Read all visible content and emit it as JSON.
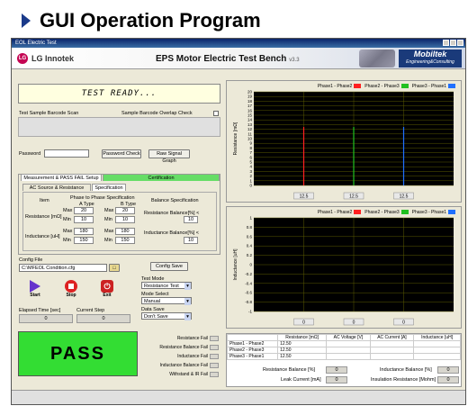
{
  "slide": {
    "title": "GUI Operation Program"
  },
  "window": {
    "title": "EOL Electric Test"
  },
  "header": {
    "company": "LG Innotek",
    "logo_mark": "LG",
    "title": "EPS Motor Electric Test Bench",
    "version": "v3.3",
    "brand": "Mobiltek",
    "brand_sub": "Engineering&Consulting"
  },
  "status": {
    "text": "TEST READY..."
  },
  "barcode": {
    "label": "Test Sample Barcode Scan",
    "overlap_label": "Sample Barcode Overlap Check"
  },
  "password": {
    "label": "Password",
    "value": "",
    "check_button": "Password Check",
    "raw_button": "Raw Signal Graph"
  },
  "setup": {
    "tab_main": "Measurement & PASS FAIL Setup",
    "tab_cert": "Certification",
    "subtab_ac": "AC Source & Resistance Setup",
    "subtab_spec": "Specification",
    "item_header": "Item",
    "phase_header": "Phase to Phase Specification",
    "a_type": "A Type",
    "b_type": "B Type",
    "balance_header": "Balance Specification",
    "resistance_label": "Resistance [mΩ]",
    "inductance_label": "Inductance [uH]",
    "max": "Max",
    "min": "Min",
    "res_a_max": "20",
    "res_a_min": "10",
    "res_b_max": "20",
    "res_b_min": "10",
    "ind_a_max": "180",
    "ind_a_min": "150",
    "ind_b_max": "180",
    "ind_b_min": "150",
    "res_balance_label": "Resistance Balance[%] <",
    "res_balance_value": "10",
    "ind_balance_label": "Inductance Balance[%] <",
    "ind_balance_value": "10"
  },
  "config": {
    "label": "Config File",
    "value": "C:\\MFEOL Condition.cfg",
    "save_button": "Config Save"
  },
  "controls": {
    "start": "Start",
    "stop": "Stop",
    "exit": "Exit"
  },
  "modes": {
    "test_mode_label": "Test Mode",
    "test_mode_value": "Resistance Test",
    "mode_select_label": "Mode Select",
    "mode_select_value": "Manual",
    "data_save_label": "Data Save",
    "data_save_value": "Don't Save"
  },
  "timing": {
    "elapsed_label": "Elapsed Time [sec]",
    "elapsed_value": "0",
    "step_label": "Current Step",
    "step_value": "0"
  },
  "result": {
    "text": "PASS",
    "color": "#33dd33"
  },
  "fails": [
    {
      "label": "Resistance Fail"
    },
    {
      "label": "Resistance Balance Fail"
    },
    {
      "label": "Inductance Fail"
    },
    {
      "label": "Inductance Balance Fail"
    },
    {
      "label": "Withstand & IR Fail"
    }
  ],
  "chart_data": [
    {
      "type": "bar",
      "categories": [
        "Phase1 - Phase2",
        "Phase2 - Phase3",
        "Phase3 - Phase1"
      ],
      "values": [
        12.5,
        12.5,
        12.5
      ],
      "colors": [
        "#ff2020",
        "#20c020",
        "#2070ff"
      ],
      "title": "",
      "xlabel": "",
      "ylabel": "Resistance [mΩ]",
      "ylim": [
        0,
        20
      ],
      "yticks": [
        "0",
        "1",
        "2",
        "3",
        "4",
        "5",
        "6",
        "7",
        "8",
        "9",
        "10",
        "11",
        "12",
        "13",
        "14",
        "15",
        "16",
        "17",
        "18",
        "19",
        "20"
      ],
      "legend": "top-right",
      "value_labels": [
        "12.5",
        "12.5",
        "12.5"
      ]
    },
    {
      "type": "bar",
      "categories": [
        "Phase1 - Phase2",
        "Phase2 - Phase3",
        "Phase3 - Phase1"
      ],
      "values": [
        0,
        0,
        0
      ],
      "colors": [
        "#ff2020",
        "#20c020",
        "#2070ff"
      ],
      "title": "",
      "xlabel": "",
      "ylabel": "Inductance [uH]",
      "ylim": [
        -1,
        1
      ],
      "yticks": [
        "-1",
        "-0.8",
        "-0.6",
        "-0.4",
        "-0.2",
        "0",
        "0.2",
        "0.4",
        "0.6",
        "0.8",
        "1"
      ],
      "legend": "top-right",
      "value_labels": [
        "0",
        "0",
        "0"
      ]
    }
  ],
  "results": {
    "headers": [
      "",
      "Resistance [mΩ]",
      "AC Voltage [V]",
      "AC Current [A]",
      "Inductance [uH]"
    ],
    "rows": [
      [
        "Phase1 - Phase2",
        "12.50",
        "",
        "",
        ""
      ],
      [
        "Phase2 - Phase3",
        "12.50",
        "",
        "",
        ""
      ],
      [
        "Phase3 - Phase1",
        "12.50",
        "",
        "",
        ""
      ]
    ],
    "res_balance_label": "Resistance Balance [%]",
    "res_balance_value": "0",
    "ind_balance_label": "Inductance Balance [%]",
    "ind_balance_value": "0",
    "leak_label": "Leak Current [mA]",
    "leak_value": "0",
    "ir_label": "Insulation Resistance [Mohm]",
    "ir_value": "0"
  }
}
